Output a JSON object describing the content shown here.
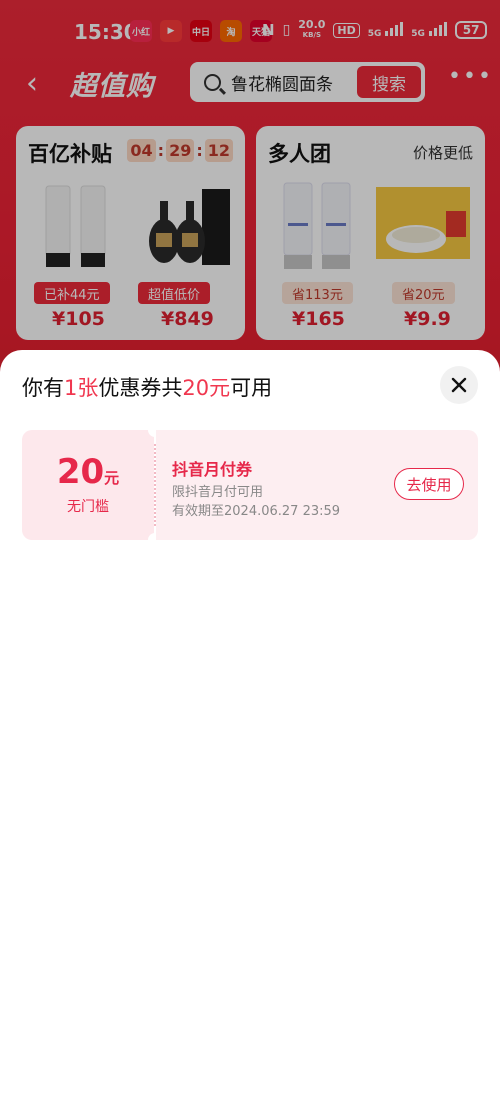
{
  "status_bar": {
    "time": "15:30",
    "net_speed": "20.0",
    "net_unit": "KB/S",
    "hd_label": "HD",
    "net_5g_1": "5G",
    "net_5g_2": "5G",
    "battery": "57",
    "app_icons": [
      {
        "name": "xiaohongshu-app-icon",
        "color": "#ff2d55",
        "label": "小红"
      },
      {
        "name": "video-app-icon",
        "color": "#ff3b3b",
        "label": "▶"
      },
      {
        "name": "news-app-icon",
        "color": "#e60012",
        "label": "中日"
      },
      {
        "name": "taobao-app-icon",
        "color": "#ff6a00",
        "label": "淘"
      },
      {
        "name": "tmall-app-icon",
        "color": "#e4002b",
        "label": "天猫"
      }
    ]
  },
  "nav": {
    "back_icon": "‹",
    "brand": "超值购",
    "search_text": "鲁花椭圆面条",
    "search_button": "搜索",
    "more_icon": "•••"
  },
  "cards": {
    "left": {
      "title": "百亿补贴",
      "timer": [
        "04",
        "29",
        "12"
      ],
      "products": [
        {
          "badge": "已补44元",
          "price": "¥105"
        },
        {
          "badge": "超值低价",
          "price": "¥849"
        }
      ]
    },
    "right": {
      "title": "多人团",
      "tag": "价格更低",
      "products": [
        {
          "badge": "省113元",
          "price": "¥165"
        },
        {
          "badge": "省20元",
          "price": "¥9.9"
        }
      ]
    }
  },
  "sheet": {
    "title_prefix": "你有",
    "title_count": "1张",
    "title_mid": "优惠券共",
    "title_amount": "20元",
    "title_suffix": "可用",
    "coupon": {
      "amount": "20",
      "unit": "元",
      "threshold": "无门槛",
      "name": "抖音月付券",
      "desc": "限抖音月付可用",
      "expire": "有效期至2024.06.27 23:59",
      "button": "去使用"
    }
  },
  "colors": {
    "accent": "#e6284a",
    "brand_red": "#ee2a3a"
  }
}
